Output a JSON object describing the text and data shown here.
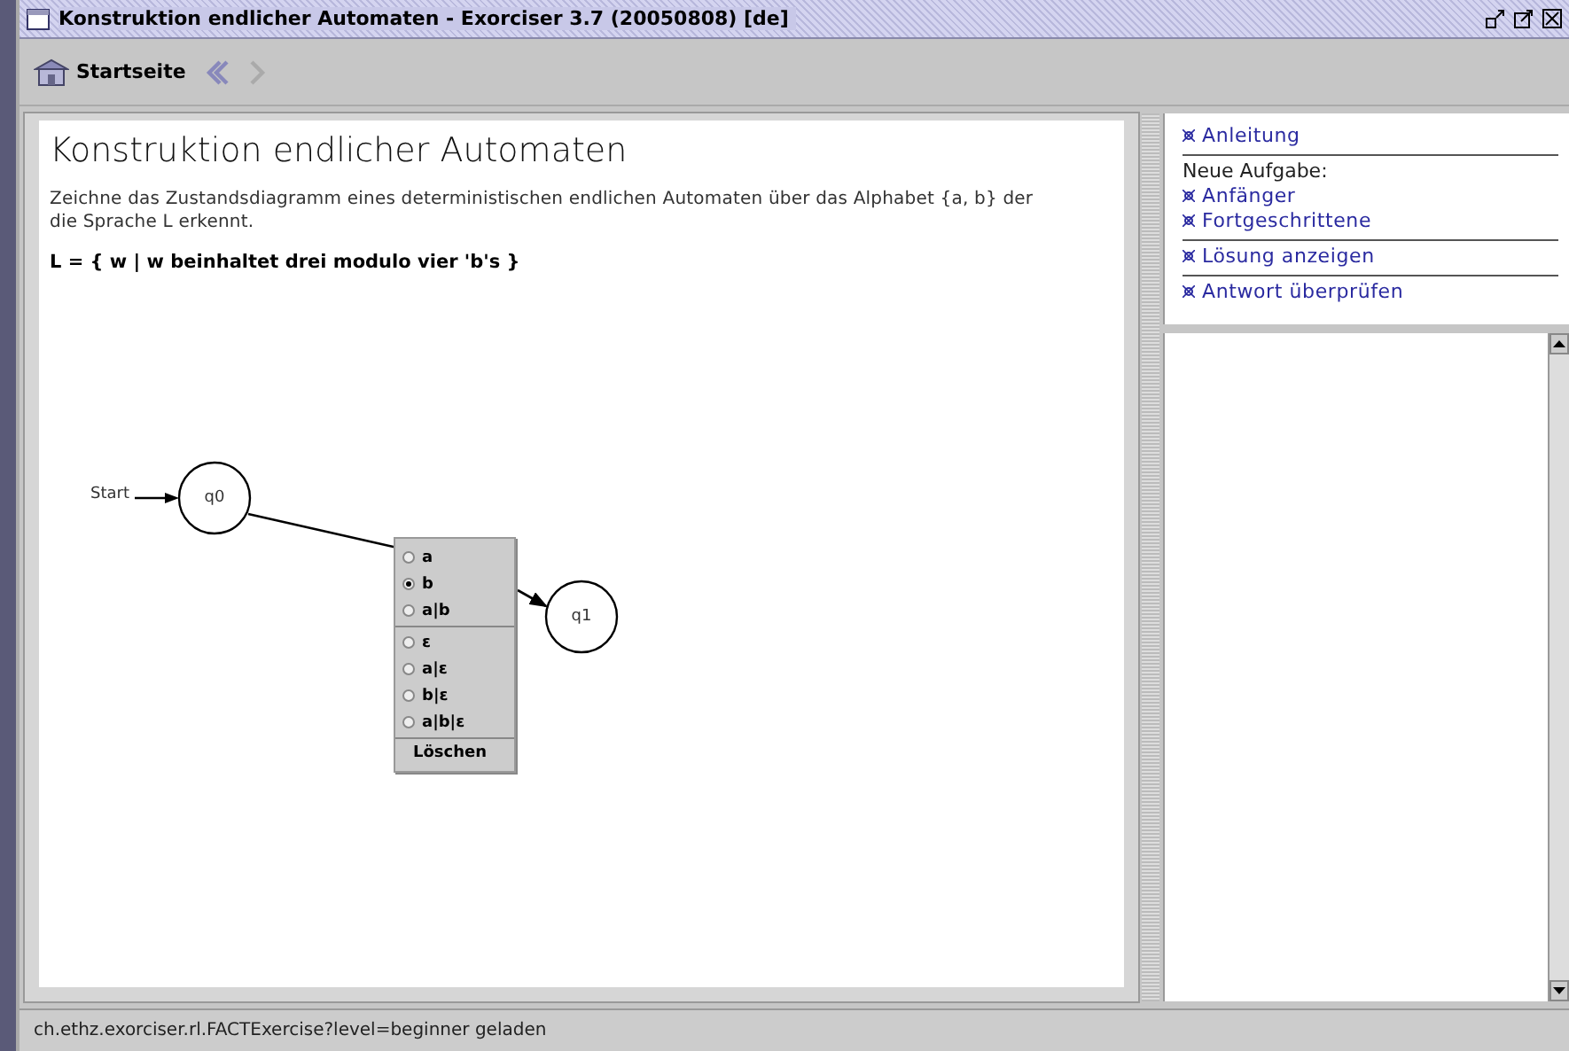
{
  "window": {
    "title": "Konstruktion endlicher Automaten - Exorciser 3.7 (20050808) [de]"
  },
  "toolbar": {
    "home": "Startseite",
    "back": {
      "disabled": false
    },
    "forward": {
      "disabled": true
    }
  },
  "exercise": {
    "title": "Konstruktion endlicher Automaten",
    "description": "Zeichne das Zustandsdiagramm eines deterministischen endlichen Automaten über das Alphabet {a, b} der die Sprache L erkennt.",
    "language": "L = { w | w beinhaltet drei modulo vier 'b's }"
  },
  "diagram": {
    "start_label": "Start",
    "states": [
      {
        "label": "q0",
        "start": true
      },
      {
        "label": "q1",
        "start": false
      }
    ]
  },
  "context_menu": {
    "groups": [
      [
        {
          "label": "a",
          "selected": false
        },
        {
          "label": "b",
          "selected": true
        },
        {
          "label": "a|b",
          "selected": false
        }
      ],
      [
        {
          "label": "ε",
          "selected": false
        },
        {
          "label": "a|ε",
          "selected": false
        },
        {
          "label": "b|ε",
          "selected": false
        },
        {
          "label": "a|b|ε",
          "selected": false
        }
      ]
    ],
    "action": "Löschen"
  },
  "sidebar": {
    "sections": [
      [
        {
          "kind": "link",
          "text": "Anleitung"
        }
      ],
      [
        {
          "kind": "label",
          "text": "Neue Aufgabe:"
        },
        {
          "kind": "link",
          "text": "Anfänger"
        },
        {
          "kind": "link",
          "text": "Fortgeschrittene"
        }
      ],
      [
        {
          "kind": "link",
          "text": "Lösung anzeigen"
        }
      ],
      [
        {
          "kind": "link",
          "text": "Antwort überprüfen"
        }
      ]
    ]
  },
  "status_bar": "ch.ethz.exorciser.rl.FACTExercise?level=beginner geladen"
}
